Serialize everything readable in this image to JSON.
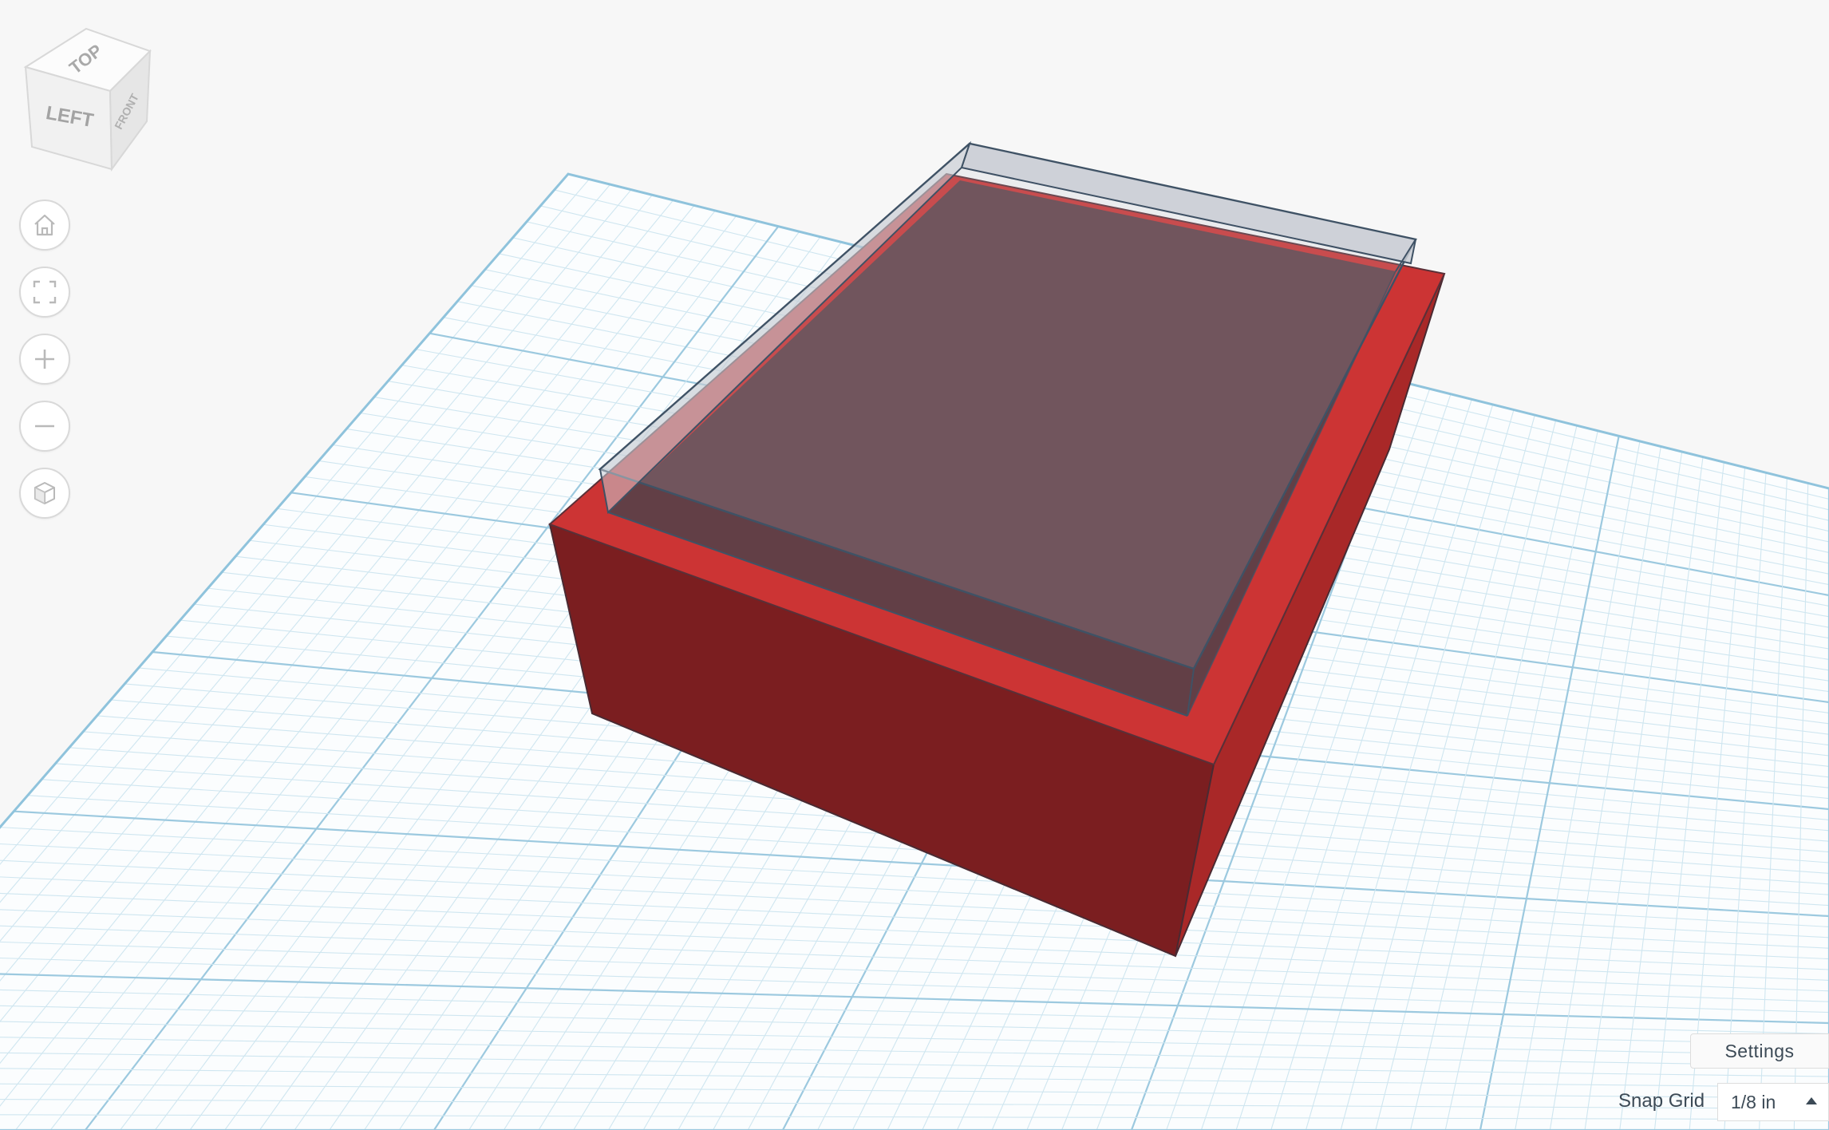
{
  "viewcube": {
    "top": "TOP",
    "left": "LEFT",
    "front": "FRONT"
  },
  "nav": [
    {
      "name": "home-view",
      "icon": "home-icon"
    },
    {
      "name": "fit-view",
      "icon": "fit-all-icon"
    },
    {
      "name": "zoom-in",
      "icon": "plus-icon"
    },
    {
      "name": "zoom-out",
      "icon": "minus-icon"
    },
    {
      "name": "projection",
      "icon": "cube-icon"
    }
  ],
  "settings_label": "Settings",
  "snap_grid": {
    "label": "Snap Grid",
    "value": "1/8 in"
  },
  "colors": {
    "grid_minor": "#cfe6f0",
    "grid_major": "#9cc9df",
    "box_front": "#7b1e20",
    "box_side": "#ab2a2a",
    "box_top": "#cc3333",
    "hole_fill": "#5e4047",
    "hole_outline": "#3f5265"
  }
}
